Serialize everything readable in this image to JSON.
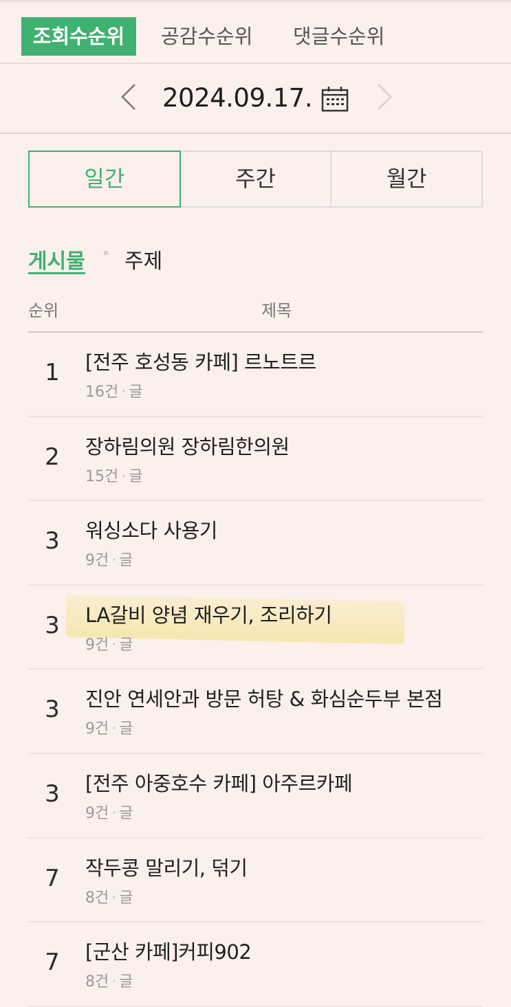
{
  "ranking_tabs": [
    {
      "label": "조회수순위",
      "active": true
    },
    {
      "label": "공감수순위",
      "active": false
    },
    {
      "label": "댓글수순위",
      "active": false
    }
  ],
  "date": {
    "text": "2024.09.17."
  },
  "period_tabs": [
    {
      "label": "일간",
      "active": true
    },
    {
      "label": "주간",
      "active": false
    },
    {
      "label": "월간",
      "active": false
    }
  ],
  "sub_tabs": [
    {
      "label": "게시물",
      "active": true
    },
    {
      "label": "주제",
      "active": false
    }
  ],
  "table_header": {
    "rank": "순위",
    "title": "제목"
  },
  "rows": [
    {
      "rank": "1",
      "title": "[전주 호성동 카페] 르노트르",
      "count": "16건",
      "type": "글"
    },
    {
      "rank": "2",
      "title": "장하림의원 장하림한의원",
      "count": "15건",
      "type": "글"
    },
    {
      "rank": "3",
      "title": "워싱소다 사용기",
      "count": "9건",
      "type": "글"
    },
    {
      "rank": "3",
      "title": "LA갈비 양념 재우기, 조리하기",
      "count": "9건",
      "type": "글",
      "highlighted": true
    },
    {
      "rank": "3",
      "title": "진안 연세안과 방문 허탕 & 화심순두부 본점",
      "count": "9건",
      "type": "글"
    },
    {
      "rank": "3",
      "title": "[전주 아중호수 카페] 아주르카페",
      "count": "9건",
      "type": "글"
    },
    {
      "rank": "7",
      "title": "작두콩 말리기, 덖기",
      "count": "8건",
      "type": "글"
    },
    {
      "rank": "7",
      "title": "[군산 카페]커피902",
      "count": "8건",
      "type": "글"
    }
  ],
  "meta_separator": "·",
  "colors": {
    "accent": "#3fb170",
    "background": "#fbf0ec",
    "highlight": "#f4e496"
  },
  "icons": {
    "prev": "chevron-left-icon",
    "next": "chevron-right-icon",
    "calendar": "calendar-icon"
  }
}
